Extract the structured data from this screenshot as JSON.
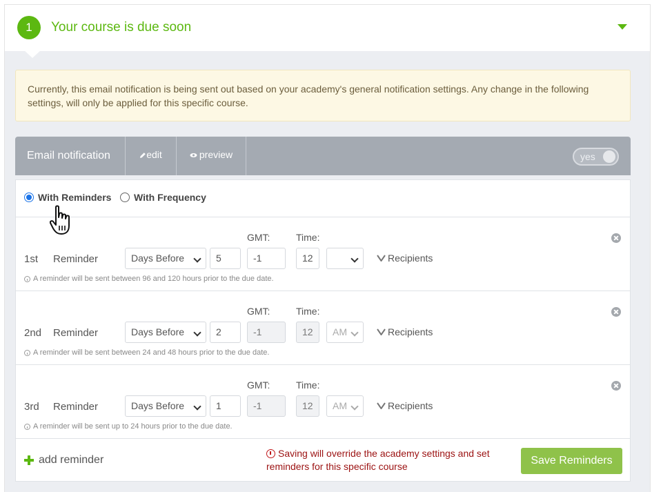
{
  "header": {
    "step_number": "1",
    "title": "Your course is due soon"
  },
  "notice": {
    "text": "Currently, this email notification is being sent out based on your academy's general notification settings. Any change in the following settings, will only be applied for this specific course."
  },
  "bar": {
    "title": "Email notification",
    "edit_label": "edit",
    "preview_label": "preview",
    "toggle_label": "yes"
  },
  "radios": {
    "with_reminders": "With Reminders",
    "with_frequency": "With Frequency",
    "selected": "with_reminders"
  },
  "labels": {
    "gmt": "GMT:",
    "time": "Time:",
    "reminder": "Reminder",
    "recipients": "Recipients"
  },
  "reminders": [
    {
      "ordinal": "1st",
      "mode": "Days Before",
      "amount": "5",
      "gmt": "-1",
      "hour": "12",
      "ampm": "",
      "hint": "A reminder will be sent between 96 and 120 hours prior to the due date."
    },
    {
      "ordinal": "2nd",
      "mode": "Days Before",
      "amount": "2",
      "gmt": "-1",
      "hour": "12",
      "ampm": "AM",
      "hint": "A reminder will be sent between 24 and 48 hours prior to the due date."
    },
    {
      "ordinal": "3rd",
      "mode": "Days Before",
      "amount": "1",
      "gmt": "-1",
      "hour": "12",
      "ampm": "AM",
      "hint": "A reminder will be sent up to 24 hours prior to the due date."
    }
  ],
  "footer": {
    "add_label": "add reminder",
    "warning": "Saving will override the academy settings and set reminders for this specific course",
    "save_label": "Save Reminders"
  },
  "colors": {
    "accent_green": "#5cb811",
    "save_green": "#8fc24a",
    "bar_gray": "#a4aab2",
    "warning_red": "#9b1111"
  }
}
